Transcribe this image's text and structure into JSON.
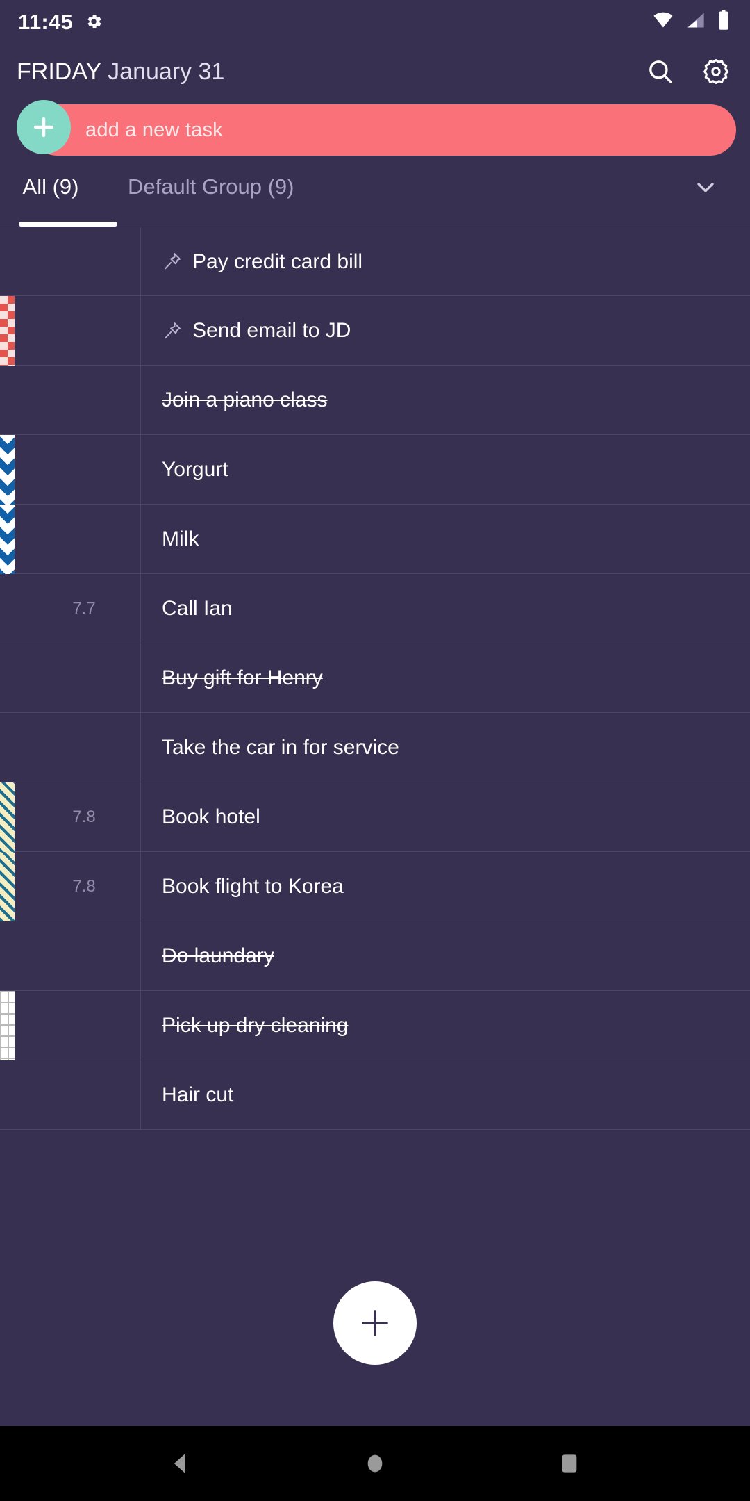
{
  "status_bar": {
    "time": "11:45",
    "gear_icon": "gear-icon",
    "wifi_icon": "wifi-icon",
    "signal_icon": "signal-icon",
    "battery_icon": "battery-icon"
  },
  "header": {
    "day_of_week": "FRIDAY",
    "month_day": "January 31",
    "search_icon": "search-icon",
    "settings_icon": "settings-gear-icon"
  },
  "add_task": {
    "placeholder": "add a new task",
    "plus_icon": "plus-icon",
    "bar_color": "#fb7179",
    "button_color": "#83d9c6"
  },
  "tabs": {
    "items": [
      {
        "label": "All (9)",
        "active": true
      },
      {
        "label": "Default Group (9)",
        "active": false
      }
    ],
    "expand_icon": "chevron-down-icon"
  },
  "tasks": [
    {
      "date": "",
      "title": "Pay credit card bill",
      "done": false,
      "pinned": true,
      "marker": "none"
    },
    {
      "date": "",
      "title": "Send email to JD",
      "done": false,
      "pinned": true,
      "marker": "checker"
    },
    {
      "date": "",
      "title": "Join a piano class",
      "done": true,
      "pinned": false,
      "marker": "none"
    },
    {
      "date": "",
      "title": "Yorgurt",
      "done": false,
      "pinned": false,
      "marker": "diamond"
    },
    {
      "date": "",
      "title": "Milk",
      "done": false,
      "pinned": false,
      "marker": "diamond"
    },
    {
      "date": "7.7",
      "title": "Call Ian",
      "done": false,
      "pinned": false,
      "marker": "none"
    },
    {
      "date": "",
      "title": "Buy gift for Henry",
      "done": true,
      "pinned": false,
      "marker": "none"
    },
    {
      "date": "",
      "title": "Take the car in for service",
      "done": false,
      "pinned": false,
      "marker": "none"
    },
    {
      "date": "7.8",
      "title": "Book hotel",
      "done": false,
      "pinned": false,
      "marker": "stripe"
    },
    {
      "date": "7.8",
      "title": "Book flight to Korea",
      "done": false,
      "pinned": false,
      "marker": "stripe"
    },
    {
      "date": "",
      "title": "Do laundary",
      "done": true,
      "pinned": false,
      "marker": "none"
    },
    {
      "date": "",
      "title": "Pick up dry cleaning",
      "done": true,
      "pinned": false,
      "marker": "grid"
    },
    {
      "date": "",
      "title": "Hair cut",
      "done": false,
      "pinned": false,
      "marker": "none"
    }
  ],
  "fab": {
    "icon": "plus-icon"
  },
  "nav_bar": {
    "back_icon": "back-triangle-icon",
    "home_icon": "home-circle-icon",
    "recents_icon": "recents-square-icon"
  },
  "colors": {
    "background": "#373050",
    "divider": "#4b4467",
    "accent_pink": "#fb7179",
    "accent_teal": "#83d9c6",
    "muted_text": "#aaa3c4"
  }
}
